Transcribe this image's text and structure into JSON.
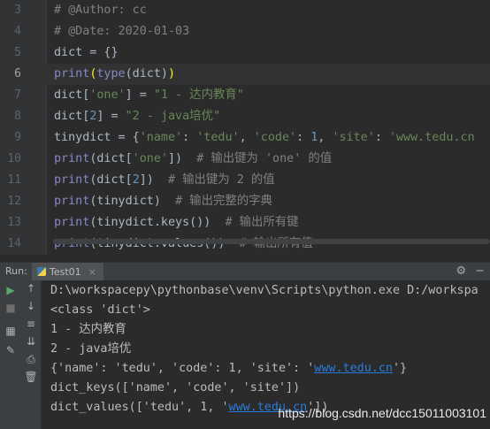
{
  "editor": {
    "lines": [
      {
        "num": "3",
        "tokens": [
          {
            "t": "# @Author: cc",
            "c": "comment"
          }
        ]
      },
      {
        "num": "4",
        "tokens": [
          {
            "t": "# @Date: 2020-01-03",
            "c": "comment"
          }
        ]
      },
      {
        "num": "5",
        "tokens": [
          {
            "t": "dict = {}",
            "c": ""
          }
        ]
      },
      {
        "num": "6",
        "current": true,
        "tokens": [
          {
            "t": "print",
            "c": "builtin"
          },
          {
            "t": "(",
            "c": "paren"
          },
          {
            "t": "type",
            "c": "builtin"
          },
          {
            "t": "(dict)",
            "c": ""
          },
          {
            "t": ")",
            "c": "paren"
          }
        ]
      },
      {
        "num": "7",
        "tokens": [
          {
            "t": "dict[",
            "c": ""
          },
          {
            "t": "'one'",
            "c": "string"
          },
          {
            "t": "] = ",
            "c": ""
          },
          {
            "t": "\"1 - 达内教育\"",
            "c": "string"
          }
        ]
      },
      {
        "num": "8",
        "tokens": [
          {
            "t": "dict[",
            "c": ""
          },
          {
            "t": "2",
            "c": "number"
          },
          {
            "t": "] = ",
            "c": ""
          },
          {
            "t": "\"2 - java培优\"",
            "c": "string"
          }
        ]
      },
      {
        "num": "9",
        "tokens": [
          {
            "t": "tinydict = {",
            "c": ""
          },
          {
            "t": "'name'",
            "c": "string"
          },
          {
            "t": ": ",
            "c": ""
          },
          {
            "t": "'tedu'",
            "c": "string"
          },
          {
            "t": ", ",
            "c": ""
          },
          {
            "t": "'code'",
            "c": "string"
          },
          {
            "t": ": ",
            "c": ""
          },
          {
            "t": "1",
            "c": "number"
          },
          {
            "t": ", ",
            "c": ""
          },
          {
            "t": "'site'",
            "c": "string"
          },
          {
            "t": ": ",
            "c": ""
          },
          {
            "t": "'www.tedu.cn",
            "c": "string"
          }
        ]
      },
      {
        "num": "10",
        "tokens": [
          {
            "t": "print",
            "c": "builtin"
          },
          {
            "t": "(dict[",
            "c": ""
          },
          {
            "t": "'one'",
            "c": "string"
          },
          {
            "t": "])  ",
            "c": ""
          },
          {
            "t": "# 输出键为 'one' 的值",
            "c": "comment"
          }
        ]
      },
      {
        "num": "11",
        "tokens": [
          {
            "t": "print",
            "c": "builtin"
          },
          {
            "t": "(dict[",
            "c": ""
          },
          {
            "t": "2",
            "c": "number"
          },
          {
            "t": "])  ",
            "c": ""
          },
          {
            "t": "# 输出键为 2 的值",
            "c": "comment"
          }
        ]
      },
      {
        "num": "12",
        "tokens": [
          {
            "t": "print",
            "c": "builtin"
          },
          {
            "t": "(tinydict)  ",
            "c": ""
          },
          {
            "t": "# 输出完整的字典",
            "c": "comment"
          }
        ]
      },
      {
        "num": "13",
        "tokens": [
          {
            "t": "print",
            "c": "builtin"
          },
          {
            "t": "(tinydict.keys())  ",
            "c": ""
          },
          {
            "t": "# 输出所有键",
            "c": "comment"
          }
        ]
      },
      {
        "num": "14",
        "tokens": [
          {
            "t": "print",
            "c": "builtin"
          },
          {
            "t": "(tinydict.values())  ",
            "c": ""
          },
          {
            "t": "# 输出所有值",
            "c": "comment"
          }
        ]
      }
    ]
  },
  "run_panel": {
    "run_label": "Run:",
    "tab_label": "Test01",
    "tab_close": "×",
    "settings_icon": "gear-icon",
    "minimize_icon": "minimize-icon",
    "output": [
      {
        "segments": [
          {
            "t": "D:\\workspacepy\\pythonbase\\venv\\Scripts\\python.exe D:/workspa"
          }
        ]
      },
      {
        "segments": [
          {
            "t": "<class 'dict'>"
          }
        ]
      },
      {
        "segments": [
          {
            "t": "1 - 达内教育"
          }
        ]
      },
      {
        "segments": [
          {
            "t": "2 - java培优"
          }
        ]
      },
      {
        "segments": [
          {
            "t": "{'name': 'tedu', 'code': 1, 'site': '"
          },
          {
            "t": "www.tedu.cn",
            "link": true
          },
          {
            "t": "'}"
          }
        ]
      },
      {
        "segments": [
          {
            "t": "dict_keys(['name', 'code', 'site'])"
          }
        ]
      },
      {
        "segments": [
          {
            "t": "dict_values(['tedu', 1, '"
          },
          {
            "t": "www.tedu.cn",
            "link": true
          },
          {
            "t": "'])"
          }
        ]
      }
    ]
  },
  "watermark": "https://blog.csdn.net/dcc15011003101",
  "colors": {
    "comment": "#808080",
    "builtin": "#8888c6",
    "string": "#6a8759",
    "number": "#6897bb",
    "paren": "#ffef28",
    "link": "#287bde"
  }
}
